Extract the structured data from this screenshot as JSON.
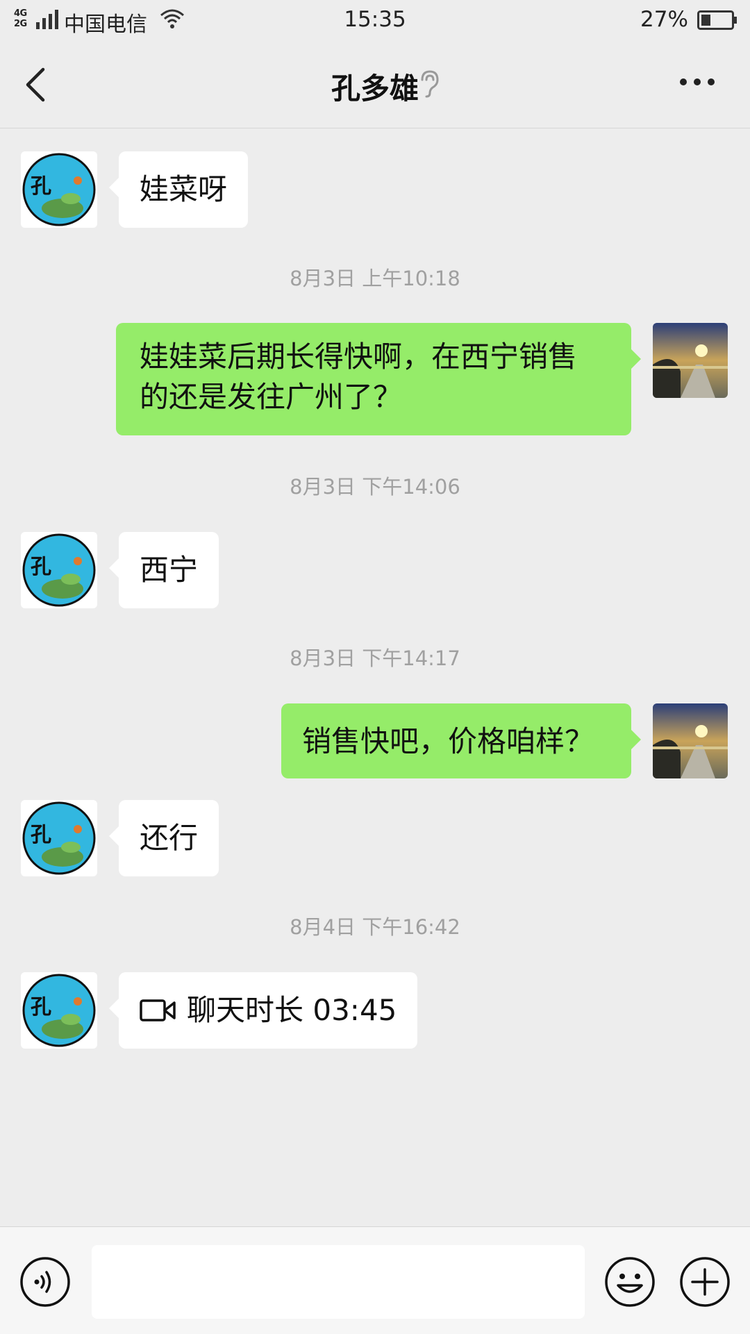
{
  "status_bar": {
    "network_top": "4G",
    "network_bottom": "2G",
    "carrier": "中国电信",
    "time": "15:35",
    "battery": "27%",
    "icons": [
      "signal-icon",
      "wifi-icon",
      "battery-icon"
    ]
  },
  "nav": {
    "title": "孔多雄",
    "icons": [
      "back-icon",
      "ear-icon",
      "more-icon"
    ]
  },
  "messages": [
    {
      "side": "left",
      "type": "text",
      "text": "娃菜呀"
    },
    {
      "type": "time",
      "text": "8月3日 上午10:18"
    },
    {
      "side": "right",
      "type": "text",
      "lines": [
        "娃娃菜后期长得快啊，在西宁销售",
        "的还是发往广州了？"
      ]
    },
    {
      "type": "time",
      "text": "8月3日 下午14:06"
    },
    {
      "side": "left",
      "type": "text",
      "text": "西宁"
    },
    {
      "type": "time",
      "text": "8月3日 下午14:17"
    },
    {
      "side": "right",
      "type": "text",
      "text": "销售快吧，价格咱样？"
    },
    {
      "side": "left",
      "type": "text",
      "text": "还行"
    },
    {
      "type": "time",
      "text": "8月4日 下午16:42"
    },
    {
      "side": "left",
      "type": "video-call",
      "text": "聊天时长 03:45",
      "icon": "video-call-icon"
    }
  ],
  "left_avatar_glyph": "孔",
  "input_bar": {
    "value": "",
    "icons": [
      "voice-icon",
      "emoji-icon",
      "plus-icon"
    ]
  },
  "colors": {
    "background": "#ededed",
    "sent_bubble": "#95ec69",
    "received_bubble": "#ffffff",
    "timestamp": "#a0a0a0"
  }
}
